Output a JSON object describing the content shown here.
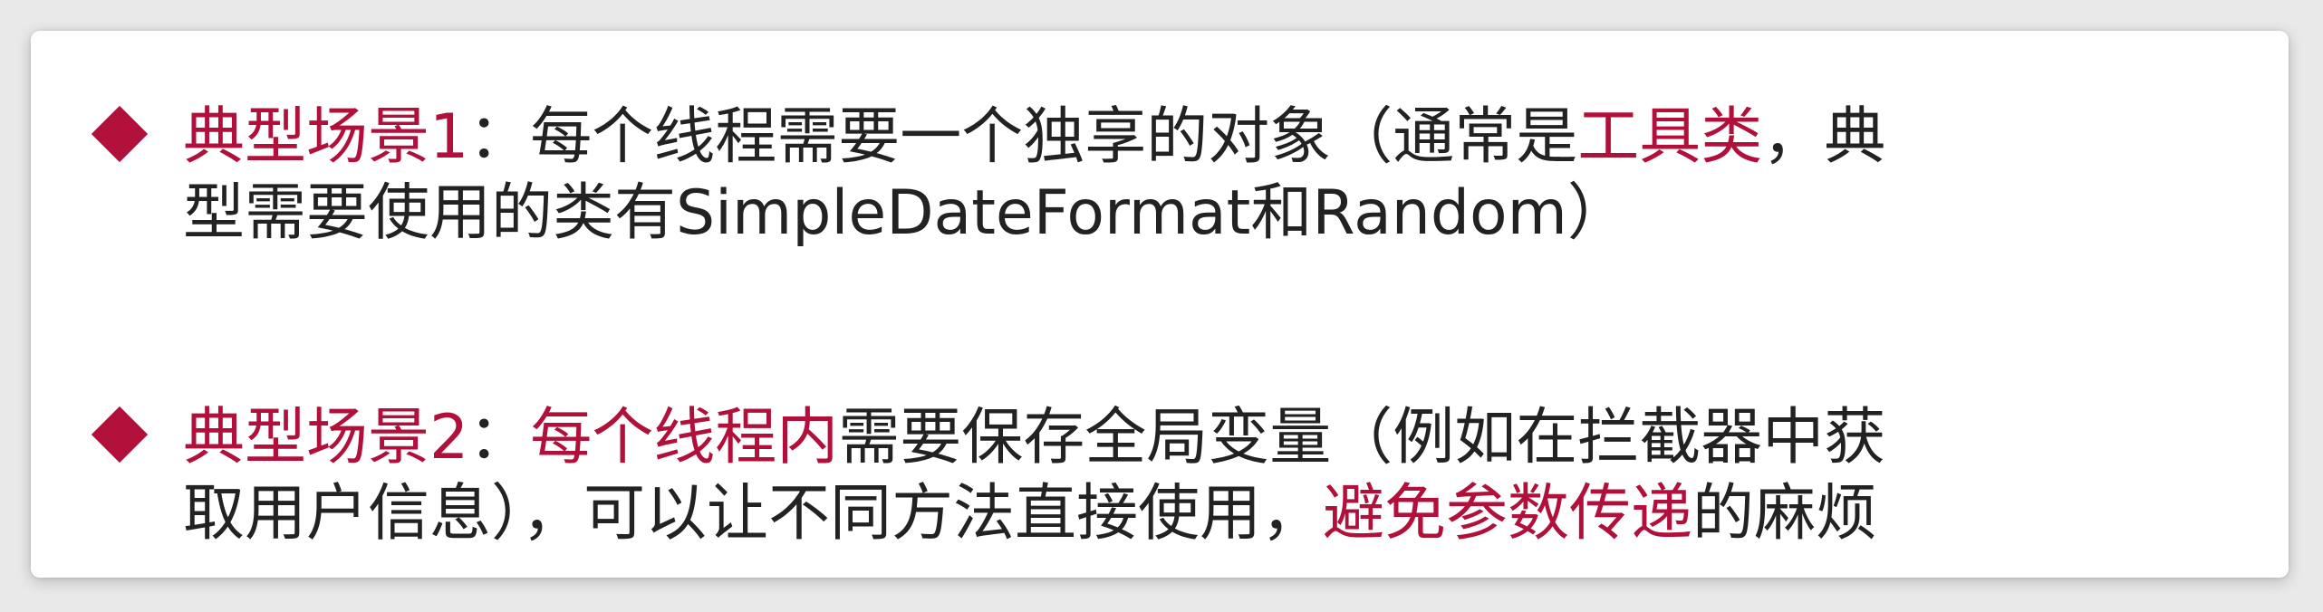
{
  "colors": {
    "accent": "#b0103a",
    "text": "#222222",
    "card": "#ffffff",
    "background": "#e9e9e9"
  },
  "bullets": [
    {
      "icon": "diamond-bullet-icon",
      "line1": {
        "title": "典型场景1",
        "colon": "：",
        "text1": "每个线程需要一个独享的对象（通常是",
        "highlight": "工具类",
        "text2": "，典"
      },
      "line2": {
        "text": "型需要使用的类有SimpleDateFormat和Random）"
      }
    },
    {
      "icon": "diamond-bullet-icon",
      "line1": {
        "title": "典型场景2",
        "colon": "：",
        "highlight": "每个线程内",
        "text": "需要保存全局变量（例如在拦截器中获"
      },
      "line2": {
        "text": "取用户信息），可以让不同方法直接使用，",
        "highlight": "避免参数传递",
        "text2": "的麻烦"
      }
    }
  ]
}
